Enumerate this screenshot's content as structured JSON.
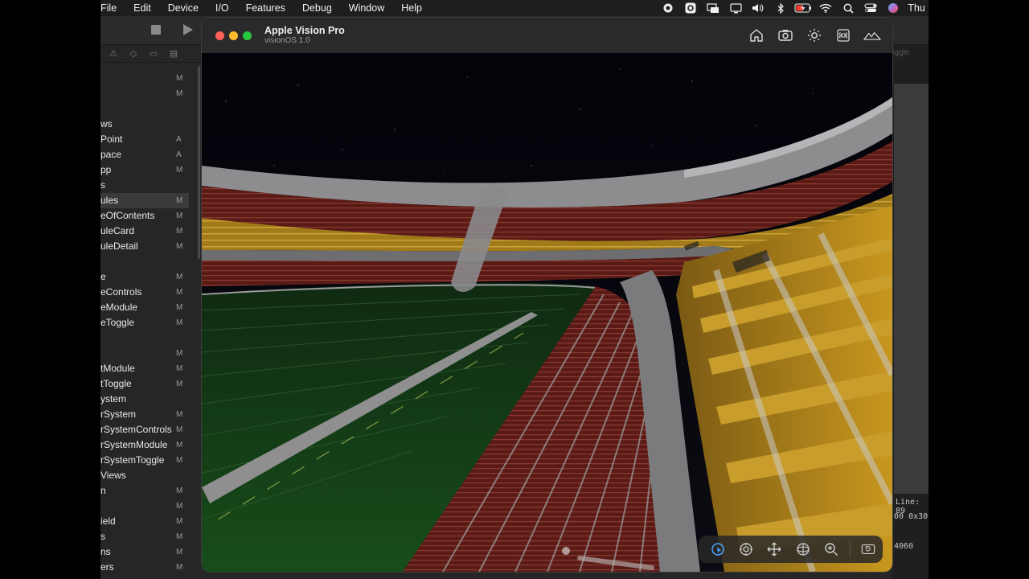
{
  "menubar": {
    "items": [
      "File",
      "Edit",
      "Device",
      "I/O",
      "Features",
      "Debug",
      "Window",
      "Help"
    ],
    "clock": "Thu",
    "status_icons": [
      "record-icon",
      "app-icon",
      "display-icon",
      "monitor-icon",
      "volume-icon",
      "bluetooth-icon",
      "battery-icon",
      "wifi-icon",
      "search-icon",
      "control-center-icon",
      "siri-icon"
    ]
  },
  "xcode": {
    "tab_ghost": "iggle",
    "navigator": [
      {
        "label": "",
        "status": "M"
      },
      {
        "label": "",
        "status": "M"
      },
      {
        "label": "",
        "status": ""
      },
      {
        "label": "ws",
        "status": ""
      },
      {
        "label": "Point",
        "status": "A"
      },
      {
        "label": "pace",
        "status": "A"
      },
      {
        "label": "pp",
        "status": "M"
      },
      {
        "label": "s",
        "status": ""
      },
      {
        "label": "ules",
        "status": "M"
      },
      {
        "label": "eOfContents",
        "status": "M"
      },
      {
        "label": "uleCard",
        "status": "M"
      },
      {
        "label": "uleDetail",
        "status": "M"
      },
      {
        "label": "",
        "status": ""
      },
      {
        "label": "e",
        "status": "M"
      },
      {
        "label": "eControls",
        "status": "M"
      },
      {
        "label": "eModule",
        "status": "M"
      },
      {
        "label": "eToggle",
        "status": "M"
      },
      {
        "label": "",
        "status": ""
      },
      {
        "label": "",
        "status": "M"
      },
      {
        "label": "tModule",
        "status": "M"
      },
      {
        "label": "tToggle",
        "status": "M"
      },
      {
        "label": "ystem",
        "status": ""
      },
      {
        "label": "rSystem",
        "status": "M"
      },
      {
        "label": "rSystemControls",
        "status": "M"
      },
      {
        "label": "rSystemModule",
        "status": "M"
      },
      {
        "label": "rSystemToggle",
        "status": "M"
      },
      {
        "label": "Views",
        "status": ""
      },
      {
        "label": "n",
        "status": "M"
      },
      {
        "label": "",
        "status": "M"
      },
      {
        "label": "ield",
        "status": "M"
      },
      {
        "label": "s",
        "status": "M"
      },
      {
        "label": "ns",
        "status": "M"
      },
      {
        "label": "ers",
        "status": "M"
      }
    ],
    "selected_index": 8,
    "console": {
      "line": "Line: 89",
      "addr": "00 0x30",
      "val": "4060"
    }
  },
  "simulator": {
    "title": "Apple Vision Pro",
    "subtitle": "visionOS 1.0",
    "tools": [
      "home-icon",
      "screenshot-icon",
      "brightness-icon",
      "command-icon",
      "environment-icon"
    ],
    "bottom_controls": [
      "interact-icon",
      "tilt-icon",
      "pan-icon",
      "orbit-icon",
      "zoom-icon",
      "camera-reset-icon"
    ]
  }
}
